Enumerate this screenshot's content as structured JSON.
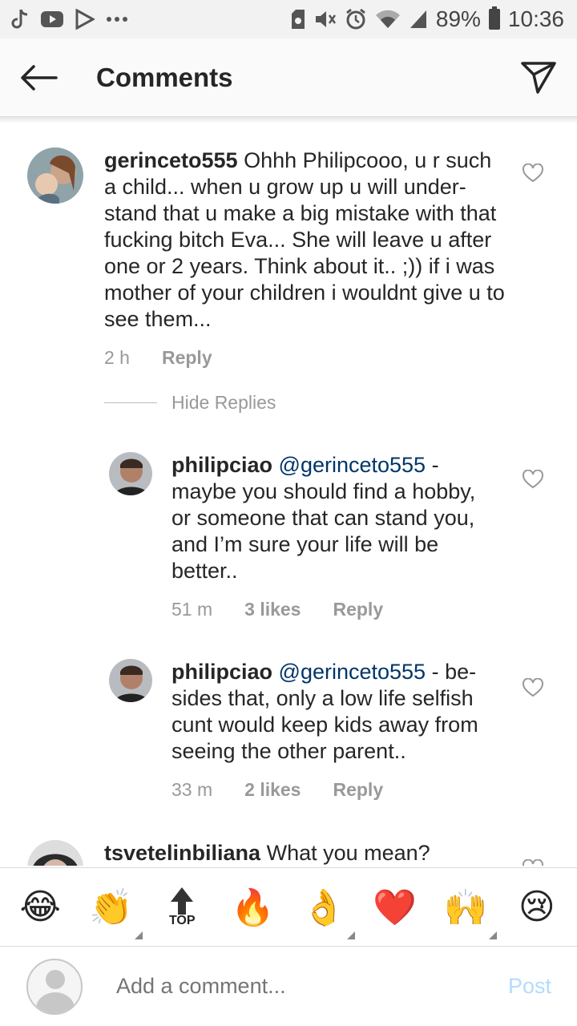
{
  "status_bar": {
    "battery": "89%",
    "time": "10:36",
    "left_icons": [
      "tiktok-icon",
      "youtube-icon",
      "play-store-icon",
      "more-dots-icon"
    ],
    "right_icons": [
      "mute-icon",
      "alarm-icon",
      "wifi-icon",
      "signal-icon",
      "battery-icon"
    ]
  },
  "header": {
    "title": "Comments"
  },
  "comments": [
    {
      "username": "gerinceto555",
      "text": "Ohhh Philipcooo, u r such a child... when u grow up u will under-stand that u make a big mistake with that fucking bitch Eva... She will leave u after one or 2 years. Think about it.. ;)) if i was mother of your children i wouldnt give u to see them...",
      "time": "2 h",
      "reply": "Reply"
    },
    {
      "username": "philipciao",
      "mention": "@gerinceto555",
      "text": "- maybe you should find a hobby, or someone that can stand you, and I’m sure your life will be better..",
      "time": "51 m",
      "likes": "3 likes",
      "reply": "Reply"
    },
    {
      "username": "philipciao",
      "mention": "@gerinceto555",
      "text": "- be-sides that, only a low life selfish cunt would keep kids away from seeing the other parent..",
      "time": "33 m",
      "likes": "2 likes",
      "reply": "Reply"
    },
    {
      "username": "tsvetelinbiliana",
      "text": "What you mean?"
    }
  ],
  "hide_replies": "Hide Replies",
  "emoji_bar": {
    "items": [
      "😂",
      "👏",
      "TOP",
      "🔥",
      "👌",
      "❤️",
      "🙌",
      "😢"
    ]
  },
  "composer": {
    "placeholder": "Add a comment...",
    "post": "Post"
  },
  "colors": {
    "mention": "#003569",
    "muted": "#999999",
    "post_disabled": "#b3dbff",
    "heart": "#e0245e"
  }
}
